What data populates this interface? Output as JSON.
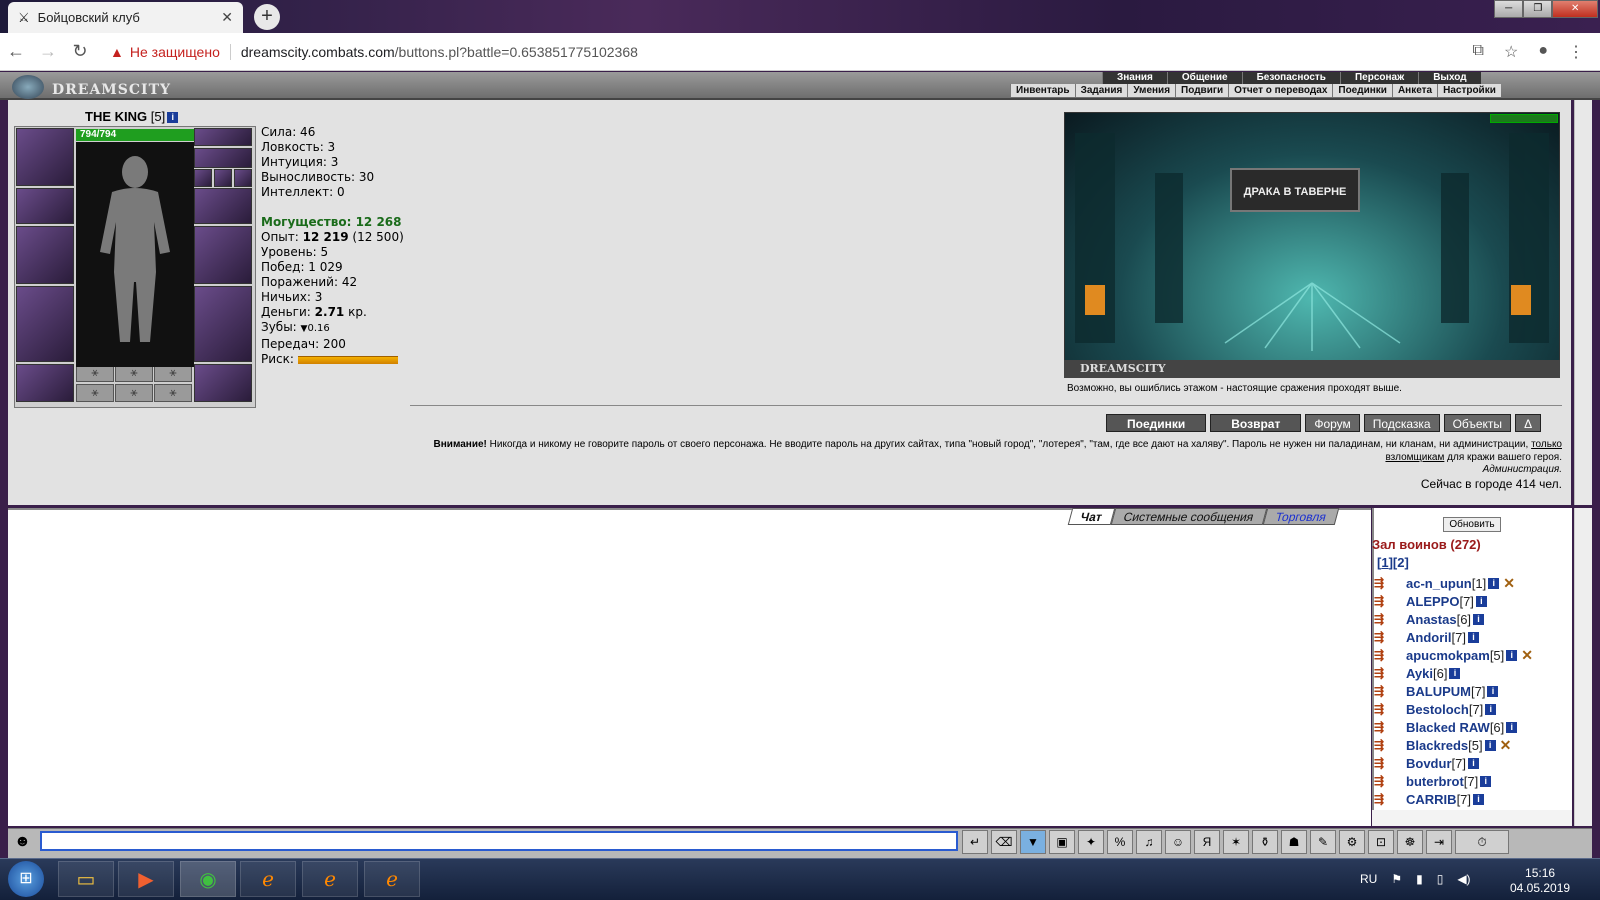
{
  "browser": {
    "tab_title": "Бойцовский клуб",
    "tab_close": "✕",
    "new_tab": "+",
    "not_secure": "Не защищено",
    "url_host": "dreamscity.combats.com",
    "url_path": "/buttons.pl?battle=0.653851775102368",
    "window_min": "─",
    "window_max": "❐",
    "window_close": "✕"
  },
  "header": {
    "logo": "DREAMSCITY",
    "menu_top": [
      "Знания",
      "Общение",
      "Безопасность",
      "Персонаж",
      "Выход"
    ],
    "menu_bottom": [
      "Инвентарь",
      "Задания",
      "Умения",
      "Подвиги",
      "Отчет о переводах",
      "Поединки",
      "Анкета",
      "Настройки"
    ]
  },
  "character": {
    "name": "THE KING",
    "level": "[5]",
    "hp": "794/794",
    "stats": [
      "Сила: 46",
      "Ловкость: 3",
      "Интуиция: 3",
      "Выносливость: 30",
      "Интеллект: 0"
    ],
    "power_label": "Могущество:",
    "power_value": "12 268",
    "exp_label": "Опыт:",
    "exp_value": "12 219",
    "exp_next": "(12 500)",
    "level_line": "Уровень: 5",
    "wins": "Побед: 1 029",
    "losses": "Поражений: 42",
    "draws": "Ничьих: 3",
    "money_label": "Деньги:",
    "money_value": "2.71",
    "money_unit": "кр.",
    "teeth_label": "Зубы:",
    "teeth_value": "0.16",
    "transfers": "Передач: 200",
    "risk_label": "Риск:"
  },
  "scene": {
    "banner": "ДРАКА В ТАВЕРНЕ",
    "footer": "DREAMSCITY",
    "note": "Возможно, вы ошиблись этажом - настоящие сражения проходят выше."
  },
  "buttons": [
    "Поединки",
    "Возврат",
    "Форум",
    "Подсказка",
    "Объекты",
    "Δ"
  ],
  "warning": {
    "bold": "Внимание!",
    "text": " Никогда и никому не говорите пароль от своего персонажа. Не вводите пароль на других сайтах, типа \"новый город\", \"лотерея\", \"там, где все дают на халяву\". Пароль не нужен ни паладинам, ни кланам, ни администрации,",
    "link": "только взломщикам",
    "tail": " для кражи вашего героя.",
    "admin": "Администрация.",
    "online": "Сейчас в городе 414 чел."
  },
  "chat": {
    "tabs": [
      "Чат",
      "Системные сообщения",
      "Торговля"
    ]
  },
  "users": {
    "refresh": "Обновить",
    "hall": "Зал воинов (272)",
    "pages": [
      "1",
      "2"
    ],
    "list": [
      {
        "name": "ac-n_upun",
        "lvl": "[1]",
        "x": true
      },
      {
        "name": "ALEPPO",
        "lvl": "[7]",
        "x": false
      },
      {
        "name": "Anastas",
        "lvl": "[6]",
        "x": false
      },
      {
        "name": "Andoril",
        "lvl": "[7]",
        "x": false
      },
      {
        "name": "apucmokpam",
        "lvl": "[5]",
        "x": true
      },
      {
        "name": "Ayki",
        "lvl": "[6]",
        "x": false
      },
      {
        "name": "BALUPUM",
        "lvl": "[7]",
        "x": false
      },
      {
        "name": "Bestoloch",
        "lvl": "[7]",
        "x": false
      },
      {
        "name": "Blacked RAW",
        "lvl": "[6]",
        "x": false
      },
      {
        "name": "Blackreds",
        "lvl": "[5]",
        "x": true
      },
      {
        "name": "Bovdur",
        "lvl": "[7]",
        "x": false
      },
      {
        "name": "buterbrot",
        "lvl": "[7]",
        "x": false
      },
      {
        "name": "CARRIB",
        "lvl": "[7]",
        "x": false
      }
    ]
  },
  "taskbar": {
    "lang": "RU",
    "time": "15:16",
    "date": "04.05.2019"
  }
}
